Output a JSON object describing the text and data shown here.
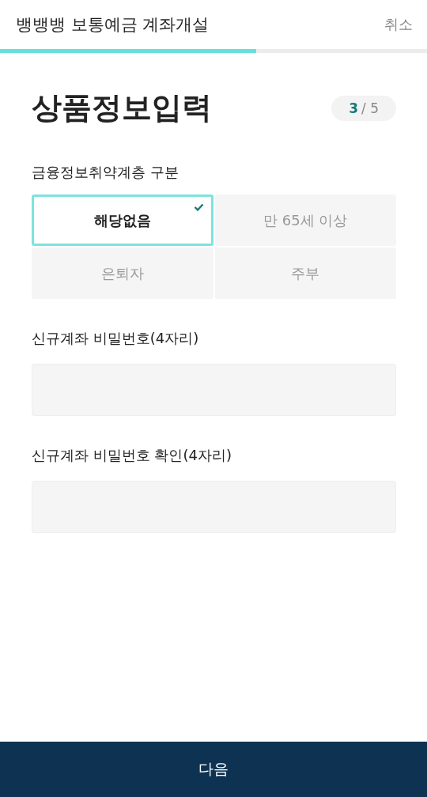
{
  "header": {
    "title": "뱅뱅뱅 보통예금 계좌개설",
    "cancel": "취소"
  },
  "progress": {
    "level": 0.6
  },
  "page_title": "상품정보입력",
  "step": {
    "current": "3",
    "separator": "/",
    "total": "5"
  },
  "vulnerable_group": {
    "label": "금융정보취약계층 구분",
    "options": [
      {
        "label": "해당없음",
        "selected": true
      },
      {
        "label": "만 65세 이상",
        "selected": false
      },
      {
        "label": "은퇴자",
        "selected": false
      },
      {
        "label": "주부",
        "selected": false
      }
    ]
  },
  "fields": [
    {
      "label": "신규계좌 비밀번호(4자리)"
    },
    {
      "label": "신규계좌 비밀번호 확인(4자리)"
    }
  ],
  "next_button": "다음"
}
